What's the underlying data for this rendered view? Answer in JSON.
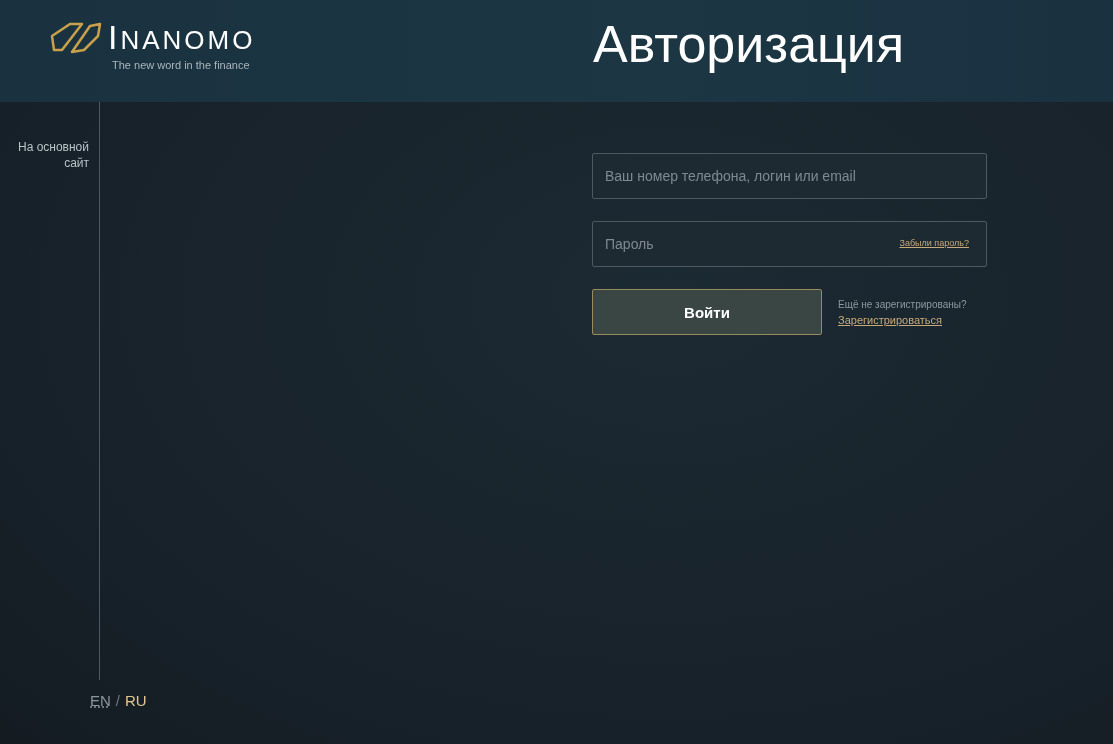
{
  "brand": {
    "name": "INANOMO",
    "tagline": "The new word in the finance"
  },
  "title": "Авторизация",
  "sidebar": {
    "link": "На основной сайт"
  },
  "form": {
    "login": {
      "placeholder": "Ваш номер телефона, логин или email"
    },
    "password": {
      "placeholder": "Пароль",
      "forgot_link": "Забыли пароль?"
    },
    "submit": "Войти",
    "register_prompt": "Ещё не зарегистрированы?",
    "register_link": "Зарегистрироваться"
  },
  "languages": {
    "separator": "/",
    "items": [
      {
        "label": "EN",
        "selected": false
      },
      {
        "label": "RU",
        "selected": true
      }
    ]
  }
}
